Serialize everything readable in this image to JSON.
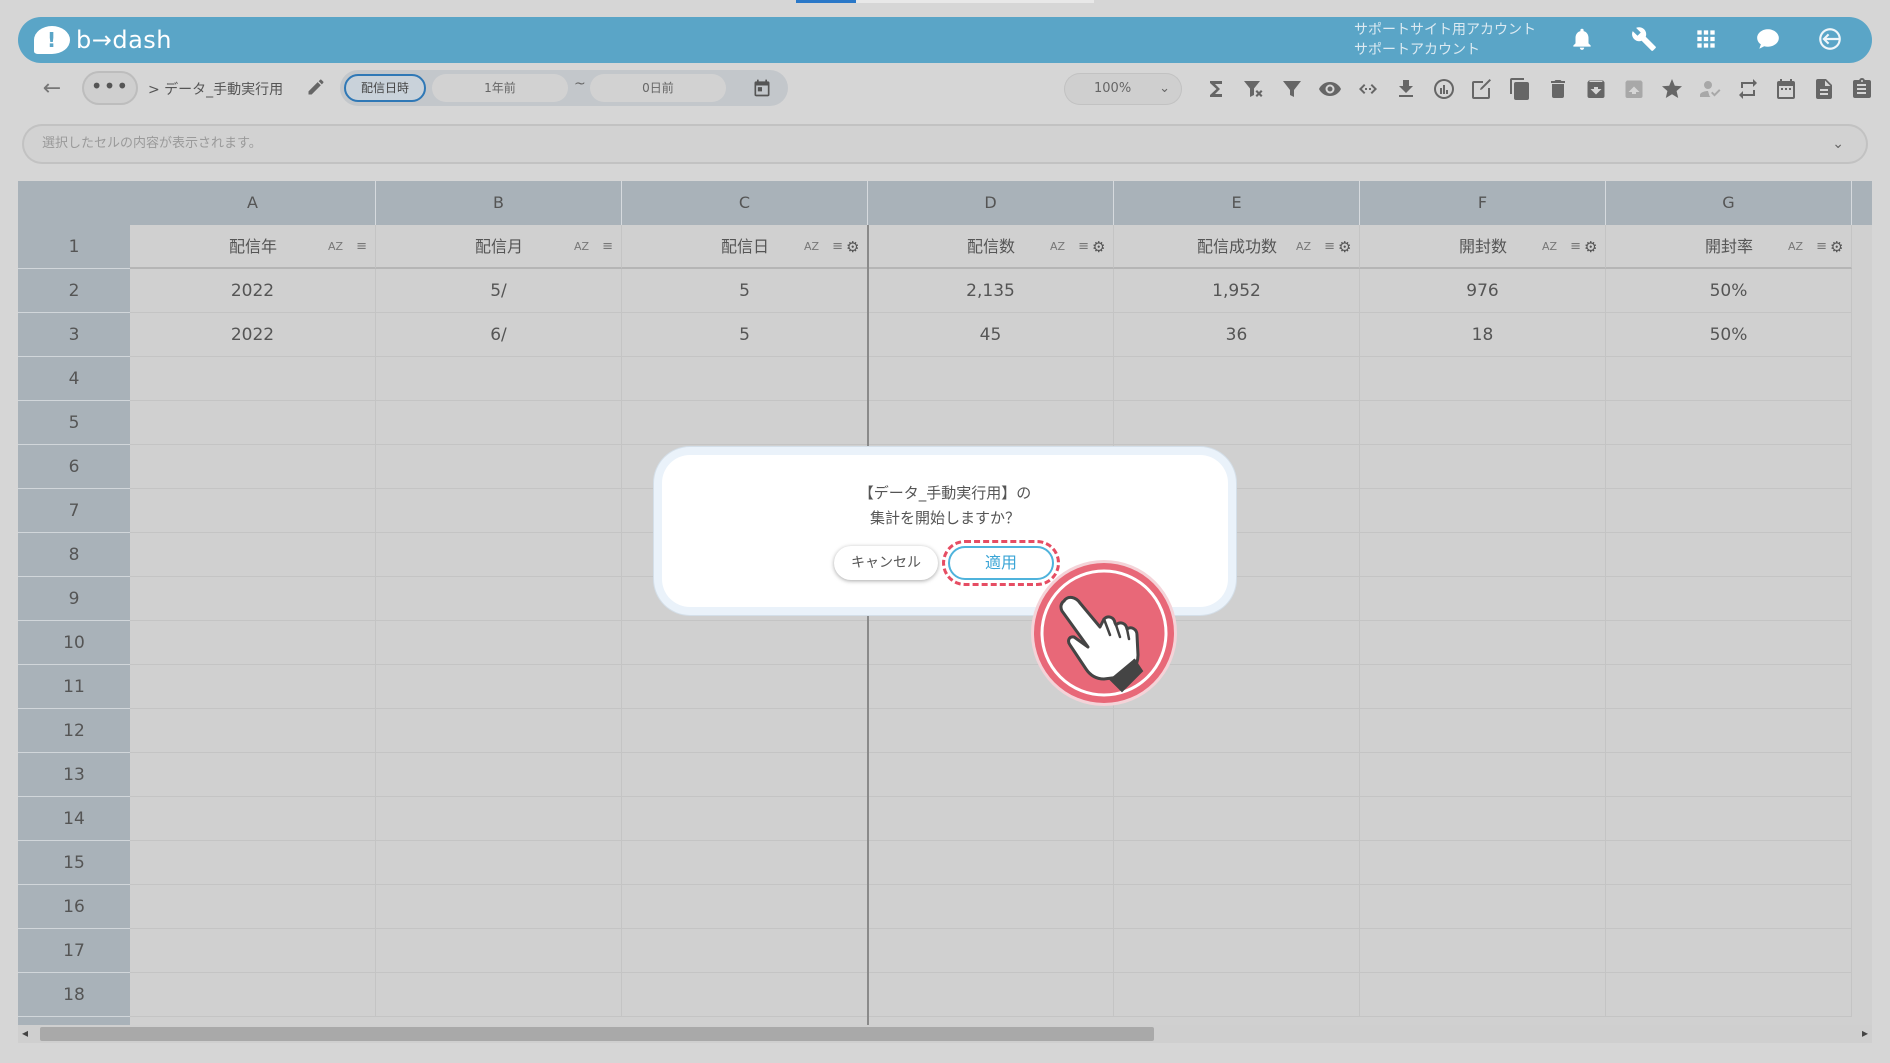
{
  "app": {
    "logo_text": "b→dash",
    "account_line1": "サポートサイト用アカウント",
    "account_line2": "サポートアカウント",
    "brand_color": "#5aa5c7"
  },
  "header_icons": [
    "bell-icon",
    "wrench-icon",
    "apps-grid-icon",
    "chat-icon",
    "logout-icon"
  ],
  "toolbar": {
    "back": "←",
    "more": "•••",
    "breadcrumb": "> データ_手動実行用",
    "date_type": "配信日時",
    "date_from": "1年前",
    "date_sep": "~",
    "date_to": "0日前",
    "zoom": "100%",
    "zoom_chevron": "⌄",
    "tool_icons": [
      "sum-icon",
      "filter-clear-icon",
      "filter-icon",
      "eye-icon",
      "code-icon",
      "download-icon",
      "chart-icon",
      "edit-icon",
      "copy-icon",
      "trash-icon",
      "archive-icon",
      "archive-disabled-icon",
      "star-icon",
      "user-check-icon",
      "repeat-icon",
      "calendar-icon",
      "document-icon",
      "clipboard-icon"
    ]
  },
  "formula_bar": {
    "placeholder": "選択したセルの内容が表示されます。",
    "chevron": "⌄"
  },
  "grid": {
    "columns": [
      "A",
      "B",
      "C",
      "D",
      "E",
      "F",
      "G"
    ],
    "header_row_num": "1",
    "headers": [
      "配信年",
      "配信月",
      "配信日",
      "配信数",
      "配信成功数",
      "開封数",
      "開封率"
    ],
    "sort_label": "AZ",
    "filter_glyph": "≡",
    "gear_glyph": "⚙",
    "rows": [
      {
        "num": "2",
        "cells": [
          "2022",
          "5/",
          "5",
          "2,135",
          "1,952",
          "976",
          "50%"
        ]
      },
      {
        "num": "3",
        "cells": [
          "2022",
          "6/",
          "5",
          "45",
          "36",
          "18",
          "50%"
        ]
      }
    ],
    "empty_row_nums": [
      "4",
      "5",
      "6",
      "7",
      "8",
      "9",
      "10",
      "11",
      "12",
      "13",
      "14",
      "15",
      "16",
      "17",
      "18"
    ]
  },
  "scrollbar": {
    "left": "◂",
    "right": "▸"
  },
  "dialog": {
    "line1": "【データ_手動実行用】の",
    "line2": "集計を開始しますか？",
    "cancel": "キャンセル",
    "apply": "適用"
  },
  "colors": {
    "highlight_dash": "#e64d63",
    "apply_border": "#4fb3dc",
    "pointer_bg": "#e86878"
  }
}
